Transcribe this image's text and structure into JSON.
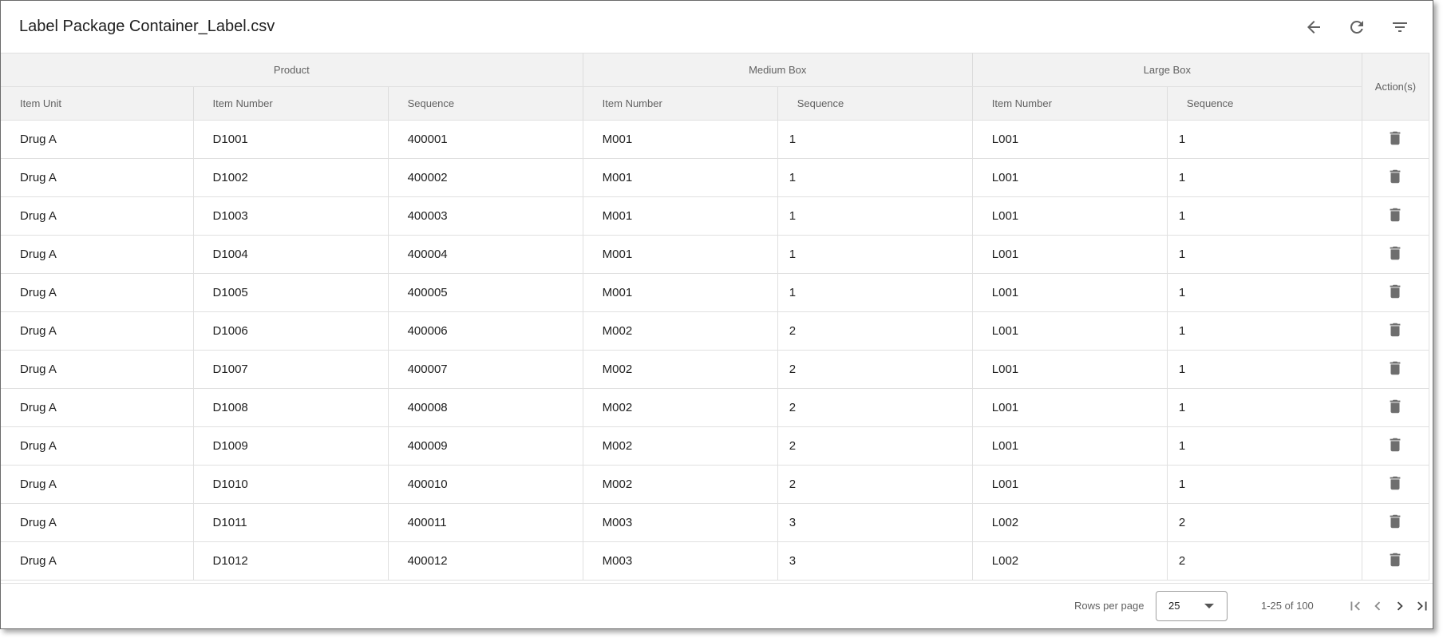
{
  "header": {
    "title": "Label Package Container_Label.csv",
    "actions": [
      "back-arrow-icon",
      "refresh-icon",
      "filter-icon"
    ]
  },
  "table": {
    "groups": [
      {
        "label": "Product"
      },
      {
        "label": "Medium Box"
      },
      {
        "label": "Large Box"
      }
    ],
    "actions_header": "Action(s)",
    "columns": [
      "Item Unit",
      "Item Number",
      "Sequence",
      "Item Number",
      "Sequence",
      "Item Number",
      "Sequence"
    ],
    "rows": [
      [
        "Drug A",
        "D1001",
        "400001",
        "M001",
        "1",
        "L001",
        "1"
      ],
      [
        "Drug A",
        "D1002",
        "400002",
        "M001",
        "1",
        "L001",
        "1"
      ],
      [
        "Drug A",
        "D1003",
        "400003",
        "M001",
        "1",
        "L001",
        "1"
      ],
      [
        "Drug A",
        "D1004",
        "400004",
        "M001",
        "1",
        "L001",
        "1"
      ],
      [
        "Drug A",
        "D1005",
        "400005",
        "M001",
        "1",
        "L001",
        "1"
      ],
      [
        "Drug A",
        "D1006",
        "400006",
        "M002",
        "2",
        "L001",
        "1"
      ],
      [
        "Drug A",
        "D1007",
        "400007",
        "M002",
        "2",
        "L001",
        "1"
      ],
      [
        "Drug A",
        "D1008",
        "400008",
        "M002",
        "2",
        "L001",
        "1"
      ],
      [
        "Drug A",
        "D1009",
        "400009",
        "M002",
        "2",
        "L001",
        "1"
      ],
      [
        "Drug A",
        "D1010",
        "400010",
        "M002",
        "2",
        "L001",
        "1"
      ],
      [
        "Drug A",
        "D1011",
        "400011",
        "M003",
        "3",
        "L002",
        "2"
      ],
      [
        "Drug A",
        "D1012",
        "400012",
        "M003",
        "3",
        "L002",
        "2"
      ]
    ],
    "row_action_icon": "trash-icon"
  },
  "footer": {
    "rows_per_page_label": "Rows per page",
    "rows_per_page_value": "25",
    "range": "1-25 of 100",
    "pager_icons": [
      "first-page-icon",
      "previous-page-icon",
      "next-page-icon",
      "last-page-icon"
    ]
  }
}
